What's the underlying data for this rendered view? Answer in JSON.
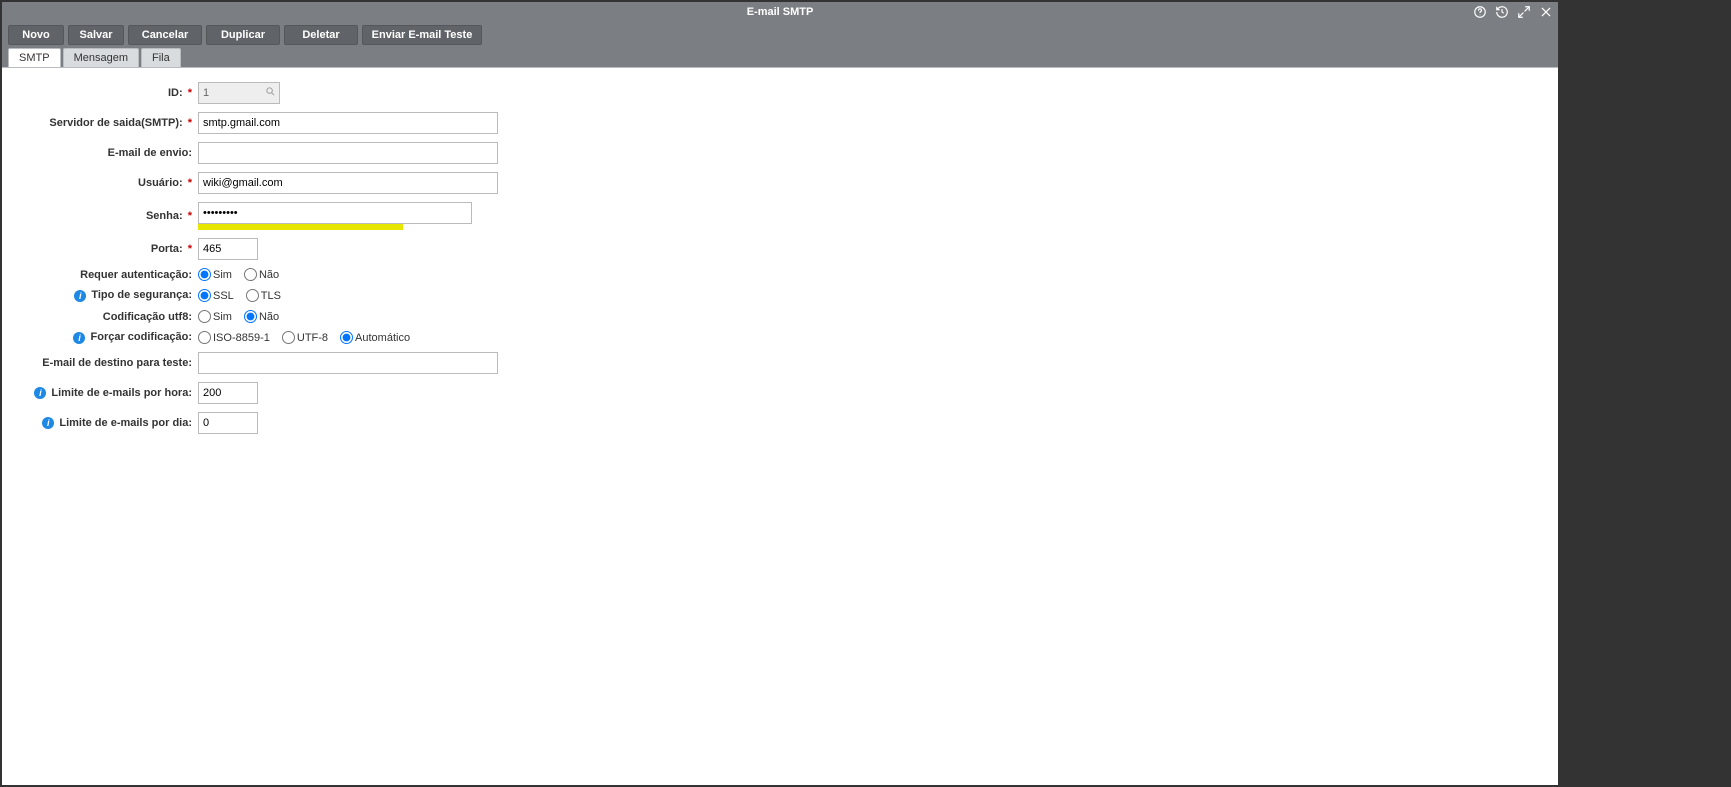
{
  "window": {
    "title": "E-mail SMTP"
  },
  "toolbar": {
    "novo": "Novo",
    "salvar": "Salvar",
    "cancelar": "Cancelar",
    "duplicar": "Duplicar",
    "deletar": "Deletar",
    "enviar_teste": "Enviar E-mail Teste"
  },
  "tabs": {
    "smtp": "SMTP",
    "mensagem": "Mensagem",
    "fila": "Fila"
  },
  "labels": {
    "id": "ID:",
    "servidor": "Servidor de saida(SMTP):",
    "email_envio": "E-mail de envio:",
    "usuario": "Usuário:",
    "senha": "Senha:",
    "porta": "Porta:",
    "requer_aut": "Requer autenticação:",
    "tipo_seguranca": "Tipo de segurança:",
    "cod_utf8": "Codificação utf8:",
    "forcar_cod": "Forçar codificação:",
    "email_teste": "E-mail de destino para teste:",
    "limite_hora": "Limite de e-mails por hora:",
    "limite_dia": "Limite de e-mails por dia:"
  },
  "values": {
    "id": "1",
    "servidor": "smtp.gmail.com",
    "email_envio": "",
    "usuario": "wiki@gmail.com",
    "senha": "•••••••••",
    "porta": "465",
    "email_teste": "",
    "limite_hora": "200",
    "limite_dia": "0"
  },
  "options": {
    "sim": "Sim",
    "nao": "Não",
    "ssl": "SSL",
    "tls": "TLS",
    "iso": "ISO-8859-1",
    "utf8": "UTF-8",
    "auto": "Automático"
  },
  "selected": {
    "requer_aut": "sim",
    "tipo_seguranca": "ssl",
    "cod_utf8": "nao",
    "forcar_cod": "auto"
  }
}
